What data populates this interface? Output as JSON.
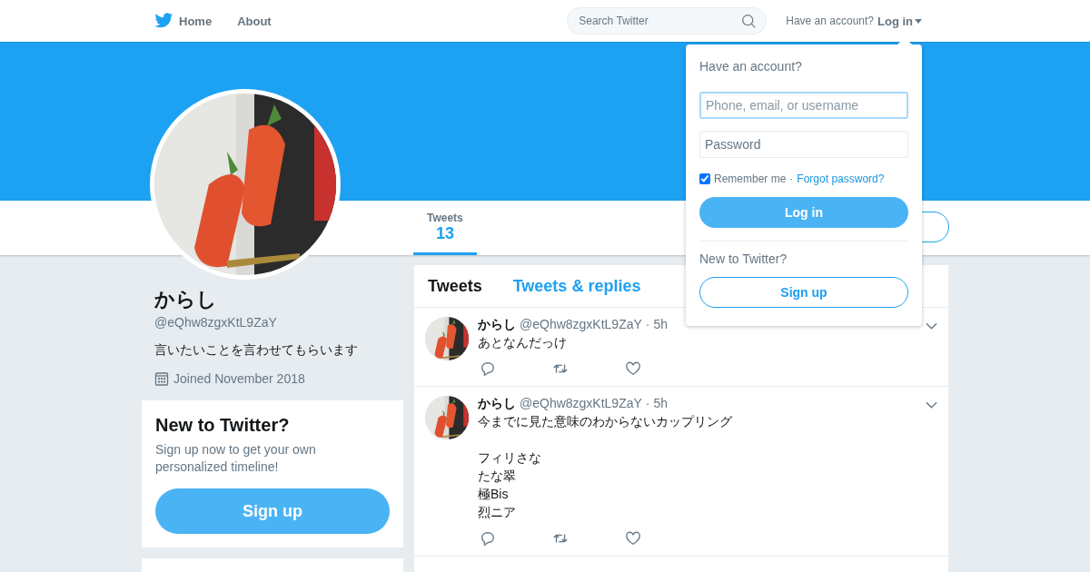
{
  "nav": {
    "links": [
      {
        "label": "Home",
        "kind": "home"
      },
      {
        "label": "About",
        "kind": "plain"
      }
    ],
    "search": {
      "placeholder": "Search Twitter"
    },
    "account_prompt": "Have an account?",
    "login_menu": "Log in"
  },
  "profile": {
    "name": "からし",
    "handle": "@eQhw8zgxKtL9ZaY",
    "bio": "言いたいことを言わせてもらいます",
    "joined": "Joined November 2018"
  },
  "stats": [
    {
      "label": "Tweets",
      "value": "13",
      "selected": true
    }
  ],
  "signup_card": {
    "title": "New to Twitter?",
    "text": "Sign up now to get your own personalized timeline!",
    "button": "Sign up"
  },
  "timeline": {
    "tabs": [
      {
        "label": "Tweets",
        "selected": true
      },
      {
        "label": "Tweets & replies",
        "selected": false
      }
    ],
    "tweets": [
      {
        "name": "からし",
        "handle": "@eQhw8zgxKtL9ZaY",
        "time": "· 5h",
        "paragraphs": [
          [
            "あとなんだっけ"
          ]
        ]
      },
      {
        "name": "からし",
        "handle": "@eQhw8zgxKtL9ZaY",
        "time": "· 5h",
        "paragraphs": [
          [
            "今までに見た意味のわからないカップリング"
          ],
          [
            "フィリさな",
            "たな翠",
            "極Bis",
            "烈ニア"
          ]
        ]
      }
    ]
  },
  "login_dropdown": {
    "title": "Have an account?",
    "username_placeholder": "Phone, email, or username",
    "password_placeholder": "Password",
    "remember_label": "Remember me",
    "remember_checked": true,
    "separator": "·",
    "forgot_link": "Forgot password?",
    "login_button": "Log in",
    "signup_prompt": "New to Twitter?",
    "signup_button": "Sign up"
  }
}
